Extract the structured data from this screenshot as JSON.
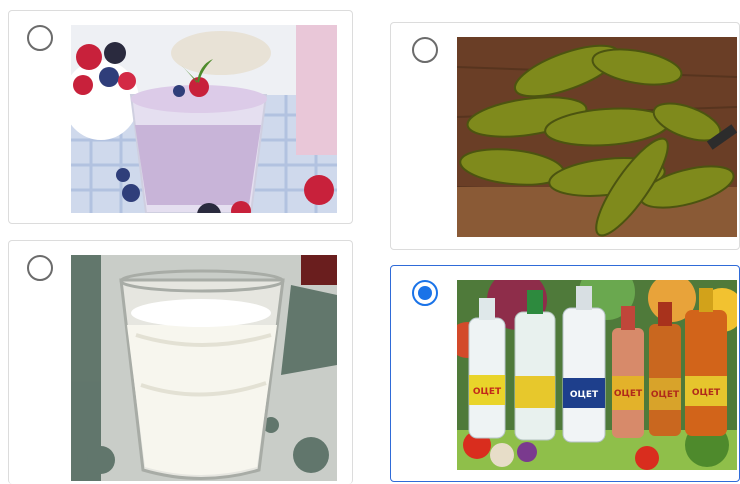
{
  "question": {
    "options": [
      {
        "id": "smoothie",
        "image": "berry-smoothie-photo",
        "selected": false
      },
      {
        "id": "pickles",
        "image": "pickled-cucumbers-photo",
        "selected": false
      },
      {
        "id": "kefir",
        "image": "kefir-glass-photo",
        "selected": false
      },
      {
        "id": "vinegar",
        "image": "vinegar-bottles-photo",
        "selected": true
      }
    ],
    "bottle_labels": [
      "ОЦЕТ",
      "ОЦЕТ",
      "ОЦЕТ",
      "ОЦЕТ",
      "ОЦЕТ"
    ]
  },
  "colors": {
    "accent": "#1a73e8",
    "card_border": "#dcdcdc",
    "selected_border": "#2f6bd8"
  }
}
